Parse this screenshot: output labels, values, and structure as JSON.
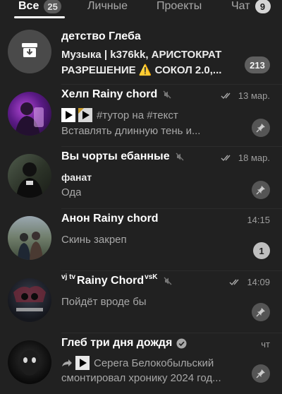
{
  "tabs": [
    {
      "label": "Все",
      "badge": "25"
    },
    {
      "label": "Личные"
    },
    {
      "label": "Проекты"
    },
    {
      "label": "Чат",
      "badge": "9"
    }
  ],
  "chats": [
    {
      "title": "детство Глеба",
      "line1": "Музыка | k376kk, АРИСТОКРАТ",
      "line2": "РАЗРЕШЕНИЕ ⚠️ СОКОЛ 2.0,...",
      "badge": "213"
    },
    {
      "title": "Хелп Rainy chord",
      "time": "13 мар.",
      "preview_line1": "#тутор на #текст",
      "preview_line2": "Вставлять длинную тень и..."
    },
    {
      "title": "Вы чорты ебанные",
      "time": "18 мар.",
      "sender": "фанат",
      "preview": "Ода"
    },
    {
      "title": "Анон Rainy chord",
      "time": "14:15",
      "preview": "Скинь закреп",
      "badge": "1"
    },
    {
      "title_prefix": "vj tv",
      "title": "Rainy Chord",
      "title_suffix": "vsK",
      "time": "14:09",
      "preview": "Пойдёт вроде бы"
    },
    {
      "title": "Глеб три дня дождя",
      "time": "чт",
      "preview_line1": "Серега Белокобыльский",
      "preview_line2": "смонтировал хронику 2024 год..."
    }
  ]
}
